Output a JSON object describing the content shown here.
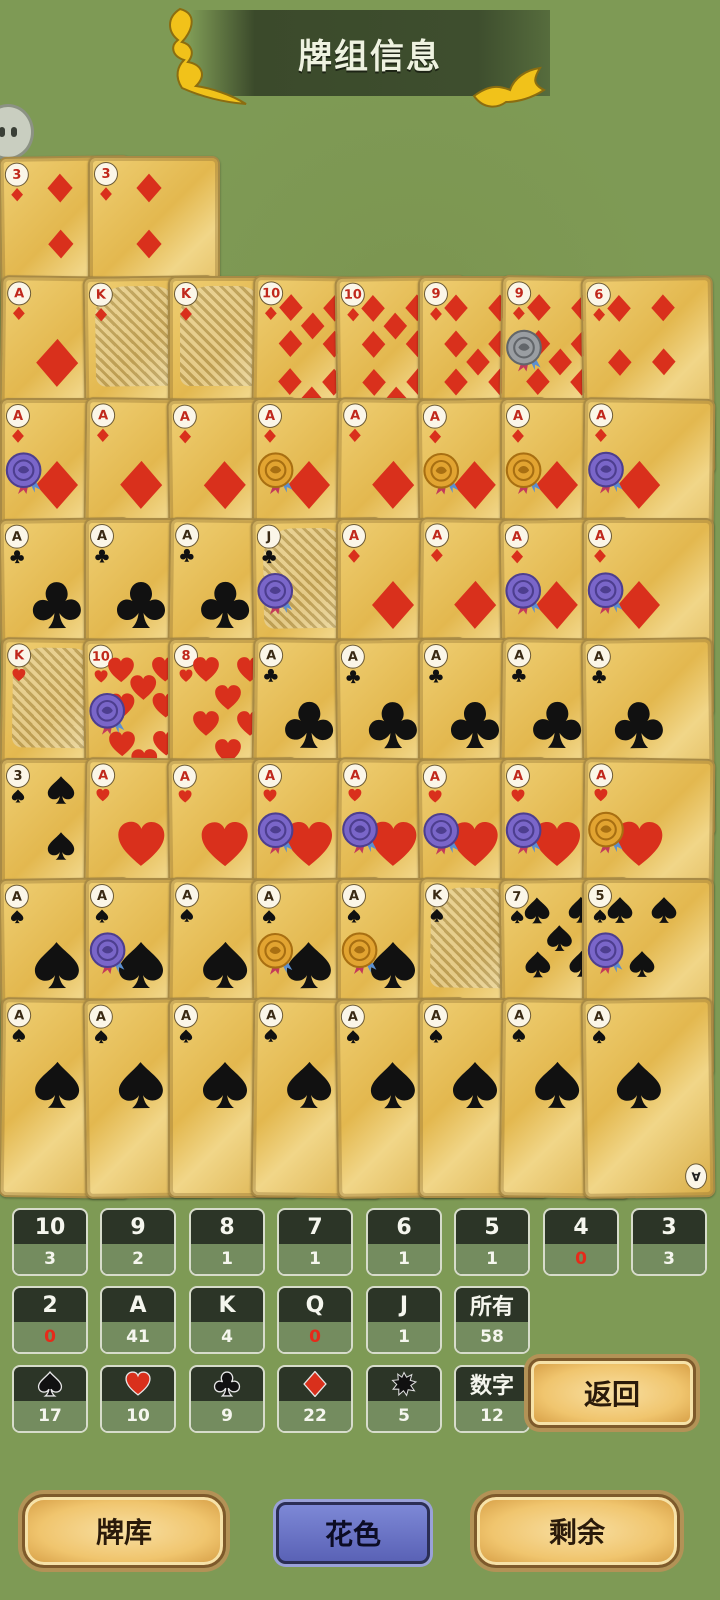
{
  "header": {
    "title": "牌组信息"
  },
  "cards": [
    {
      "row": 0,
      "col": 0,
      "rank": "3",
      "suit": "diamond",
      "layout": "three"
    },
    {
      "row": 0,
      "col": 1,
      "rank": "3",
      "suit": "diamond",
      "layout": "three"
    },
    {
      "row": 1,
      "col": 0,
      "rank": "A",
      "suit": "diamond",
      "layout": "ace"
    },
    {
      "row": 1,
      "col": 1,
      "rank": "K",
      "suit": "diamond",
      "layout": "face"
    },
    {
      "row": 1,
      "col": 2,
      "rank": "K",
      "suit": "diamond",
      "layout": "face"
    },
    {
      "row": 1,
      "col": 3,
      "rank": "10",
      "suit": "diamond",
      "layout": "many"
    },
    {
      "row": 1,
      "col": 4,
      "rank": "10",
      "suit": "diamond",
      "layout": "many"
    },
    {
      "row": 1,
      "col": 5,
      "rank": "9",
      "suit": "diamond",
      "layout": "many"
    },
    {
      "row": 1,
      "col": 6,
      "rank": "9",
      "suit": "diamond",
      "layout": "many",
      "seal": "gray"
    },
    {
      "row": 1,
      "col": 7,
      "rank": "6",
      "suit": "diamond",
      "layout": "many"
    },
    {
      "row": 2,
      "col": 0,
      "rank": "A",
      "suit": "diamond",
      "layout": "ace",
      "seal": "purple"
    },
    {
      "row": 2,
      "col": 1,
      "rank": "A",
      "suit": "diamond",
      "layout": "ace"
    },
    {
      "row": 2,
      "col": 2,
      "rank": "A",
      "suit": "diamond",
      "layout": "ace"
    },
    {
      "row": 2,
      "col": 3,
      "rank": "A",
      "suit": "diamond",
      "layout": "ace",
      "seal": "gold"
    },
    {
      "row": 2,
      "col": 4,
      "rank": "A",
      "suit": "diamond",
      "layout": "ace"
    },
    {
      "row": 2,
      "col": 5,
      "rank": "A",
      "suit": "diamond",
      "layout": "ace",
      "seal": "gold"
    },
    {
      "row": 2,
      "col": 6,
      "rank": "A",
      "suit": "diamond",
      "layout": "ace",
      "seal": "gold"
    },
    {
      "row": 2,
      "col": 7,
      "rank": "A",
      "suit": "diamond",
      "layout": "ace",
      "seal": "purple"
    },
    {
      "row": 3,
      "col": 0,
      "rank": "A",
      "suit": "club",
      "layout": "ace"
    },
    {
      "row": 3,
      "col": 1,
      "rank": "A",
      "suit": "club",
      "layout": "ace"
    },
    {
      "row": 3,
      "col": 2,
      "rank": "A",
      "suit": "club",
      "layout": "ace"
    },
    {
      "row": 3,
      "col": 3,
      "rank": "J",
      "suit": "club",
      "layout": "face",
      "seal": "purple"
    },
    {
      "row": 3,
      "col": 4,
      "rank": "A",
      "suit": "diamond",
      "layout": "ace"
    },
    {
      "row": 3,
      "col": 5,
      "rank": "A",
      "suit": "diamond",
      "layout": "ace"
    },
    {
      "row": 3,
      "col": 6,
      "rank": "A",
      "suit": "diamond",
      "layout": "ace",
      "seal": "purple"
    },
    {
      "row": 3,
      "col": 7,
      "rank": "A",
      "suit": "diamond",
      "layout": "ace",
      "seal": "purple"
    },
    {
      "row": 4,
      "col": 0,
      "rank": "K",
      "suit": "heart",
      "layout": "face"
    },
    {
      "row": 4,
      "col": 1,
      "rank": "10",
      "suit": "heart",
      "layout": "many",
      "seal": "purple"
    },
    {
      "row": 4,
      "col": 2,
      "rank": "8",
      "suit": "heart",
      "layout": "many"
    },
    {
      "row": 4,
      "col": 3,
      "rank": "A",
      "suit": "club",
      "layout": "ace"
    },
    {
      "row": 4,
      "col": 4,
      "rank": "A",
      "suit": "club",
      "layout": "ace"
    },
    {
      "row": 4,
      "col": 5,
      "rank": "A",
      "suit": "club",
      "layout": "ace"
    },
    {
      "row": 4,
      "col": 6,
      "rank": "A",
      "suit": "club",
      "layout": "ace"
    },
    {
      "row": 4,
      "col": 7,
      "rank": "A",
      "suit": "club",
      "layout": "ace"
    },
    {
      "row": 5,
      "col": 0,
      "rank": "3",
      "suit": "spade",
      "layout": "three"
    },
    {
      "row": 5,
      "col": 1,
      "rank": "A",
      "suit": "heart",
      "layout": "ace"
    },
    {
      "row": 5,
      "col": 2,
      "rank": "A",
      "suit": "heart",
      "layout": "ace"
    },
    {
      "row": 5,
      "col": 3,
      "rank": "A",
      "suit": "heart",
      "layout": "ace",
      "seal": "purple"
    },
    {
      "row": 5,
      "col": 4,
      "rank": "A",
      "suit": "heart",
      "layout": "ace",
      "seal": "purple"
    },
    {
      "row": 5,
      "col": 5,
      "rank": "A",
      "suit": "heart",
      "layout": "ace",
      "seal": "purple"
    },
    {
      "row": 5,
      "col": 6,
      "rank": "A",
      "suit": "heart",
      "layout": "ace",
      "seal": "purple"
    },
    {
      "row": 5,
      "col": 7,
      "rank": "A",
      "suit": "heart",
      "layout": "ace",
      "seal": "gold"
    },
    {
      "row": 6,
      "col": 0,
      "rank": "A",
      "suit": "spade",
      "layout": "ace"
    },
    {
      "row": 6,
      "col": 1,
      "rank": "A",
      "suit": "spade",
      "layout": "ace",
      "seal": "purple"
    },
    {
      "row": 6,
      "col": 2,
      "rank": "A",
      "suit": "spade",
      "layout": "ace"
    },
    {
      "row": 6,
      "col": 3,
      "rank": "A",
      "suit": "spade",
      "layout": "ace",
      "seal": "gold"
    },
    {
      "row": 6,
      "col": 4,
      "rank": "A",
      "suit": "spade",
      "layout": "ace",
      "seal": "gold"
    },
    {
      "row": 6,
      "col": 5,
      "rank": "K",
      "suit": "spade",
      "layout": "face"
    },
    {
      "row": 6,
      "col": 6,
      "rank": "7",
      "suit": "spade",
      "layout": "many"
    },
    {
      "row": 6,
      "col": 7,
      "rank": "5",
      "suit": "spade",
      "layout": "many",
      "seal": "purple"
    },
    {
      "row": 7,
      "col": 0,
      "rank": "A",
      "suit": "spade",
      "layout": "ace"
    },
    {
      "row": 7,
      "col": 1,
      "rank": "A",
      "suit": "spade",
      "layout": "ace"
    },
    {
      "row": 7,
      "col": 2,
      "rank": "A",
      "suit": "spade",
      "layout": "ace"
    },
    {
      "row": 7,
      "col": 3,
      "rank": "A",
      "suit": "spade",
      "layout": "ace"
    },
    {
      "row": 7,
      "col": 4,
      "rank": "A",
      "suit": "spade",
      "layout": "ace"
    },
    {
      "row": 7,
      "col": 5,
      "rank": "A",
      "suit": "spade",
      "layout": "ace"
    },
    {
      "row": 7,
      "col": 6,
      "rank": "A",
      "suit": "spade",
      "layout": "ace"
    },
    {
      "row": 7,
      "col": 7,
      "rank": "A",
      "suit": "spade",
      "layout": "ace",
      "corner": "A"
    }
  ],
  "stats": [
    {
      "label": "10",
      "count": "3"
    },
    {
      "label": "9",
      "count": "2"
    },
    {
      "label": "8",
      "count": "1"
    },
    {
      "label": "7",
      "count": "1"
    },
    {
      "label": "6",
      "count": "1"
    },
    {
      "label": "5",
      "count": "1"
    },
    {
      "label": "4",
      "count": "0"
    },
    {
      "label": "3",
      "count": "3"
    },
    {
      "label": "2",
      "count": "0"
    },
    {
      "label": "A",
      "count": "41"
    },
    {
      "label": "K",
      "count": "4"
    },
    {
      "label": "Q",
      "count": "0"
    },
    {
      "label": "J",
      "count": "1"
    },
    {
      "label": "所有",
      "count": "58"
    },
    {
      "icon": "spade",
      "count": "17"
    },
    {
      "icon": "heart",
      "count": "10"
    },
    {
      "icon": "club",
      "count": "9"
    },
    {
      "icon": "diamond",
      "count": "22"
    },
    {
      "icon": "splat",
      "count": "5"
    },
    {
      "label": "数字",
      "count": "12"
    }
  ],
  "buttons": {
    "back": "返回",
    "deck": "牌库",
    "suits": "花色",
    "remaining": "剩余"
  },
  "colors": {
    "background": "#7e9a55",
    "red_suit": "#d9301c",
    "black_suit": "#111111",
    "zero_count": "#e62a1a",
    "active_tab": "#6a72c4"
  }
}
